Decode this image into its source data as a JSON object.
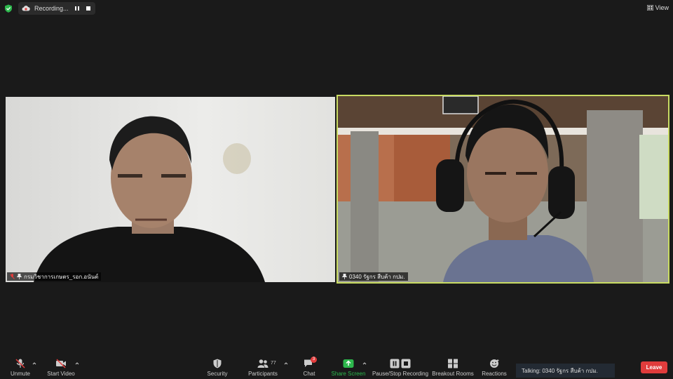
{
  "top_bar": {
    "recording_label": "Recording...",
    "view_label": "View"
  },
  "participants": [
    {
      "name": "กรมวิชาการเกษตร_รอก.อนันต์",
      "muted": true,
      "active_speaker": false
    },
    {
      "name": "0340 รัฐกร  สืบค้า กปม.",
      "muted": false,
      "active_speaker": true
    }
  ],
  "toolbar": {
    "unmute_label": "Unmute",
    "start_video_label": "Start Video",
    "security_label": "Security",
    "participants_label": "Participants",
    "participants_count": "77",
    "chat_label": "Chat",
    "chat_badge": "3",
    "share_screen_label": "Share Screen",
    "pause_stop_recording_label": "Pause/Stop Recording",
    "breakout_rooms_label": "Breakout Rooms",
    "reactions_label": "Reactions",
    "leave_label": "Leave"
  },
  "talking_indicator": "Talking: 0340 รัฐกร  สืบค้า กปม.",
  "colors": {
    "background": "#1a1a1a",
    "active_speaker_border": "#c9dc63",
    "leave_button": "#e03c3c",
    "share_screen_green": "#2db84d",
    "shield_green": "#2db84d",
    "muted_red": "#e23c3c"
  }
}
